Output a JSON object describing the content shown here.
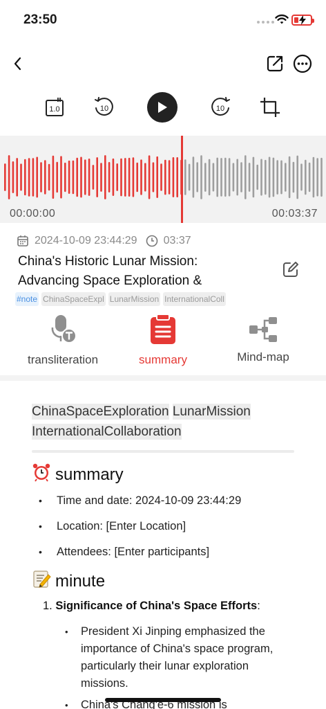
{
  "status_bar": {
    "time": "23:50"
  },
  "controls": {
    "speed_label": "1.0",
    "rewind_label": "10",
    "forward_label": "10"
  },
  "waveform": {
    "start_time": "00:00:00",
    "end_time": "00:03:37",
    "played_fraction": 0.555
  },
  "recording": {
    "date": "2024-10-09 23:44:29",
    "duration": "03:37",
    "title": "China's Historic Lunar Mission: Advancing Space Exploration &",
    "tags": [
      "#note",
      "ChinaSpaceExpl",
      "LunarMission",
      "InternationalColl"
    ]
  },
  "tabs": [
    {
      "label": "transliteration",
      "icon": "speech-to-text-icon"
    },
    {
      "label": "summary",
      "icon": "clipboard-list-icon"
    },
    {
      "label": "Mind-map",
      "icon": "mind-map-icon"
    }
  ],
  "colors": {
    "accent": "#e53935",
    "played_wave": "#e53935",
    "unplayed_wave": "#9e9e9e"
  },
  "content": {
    "hashtags": [
      "ChinaSpaceExploration",
      "LunarMission",
      "InternationalCollaboration"
    ],
    "summary_heading": "summary",
    "summary_emoji": "⏰",
    "summary_items": [
      "Time and date: 2024-10-09 23:44:29",
      "Location: [Enter Location]",
      "Attendees: [Enter participants]"
    ],
    "minute_heading": "minute",
    "minute_emoji": "📝",
    "minute_item_1_number": "1.",
    "minute_item_1_title": "Significance of China's Space Efforts",
    "minute_item_1_suffix": ":",
    "minute_item_1_points": [
      "President Xi Jinping emphasized the importance of China's space program, particularly their lunar exploration missions.",
      "China's Chang'e-6 mission is"
    ]
  }
}
